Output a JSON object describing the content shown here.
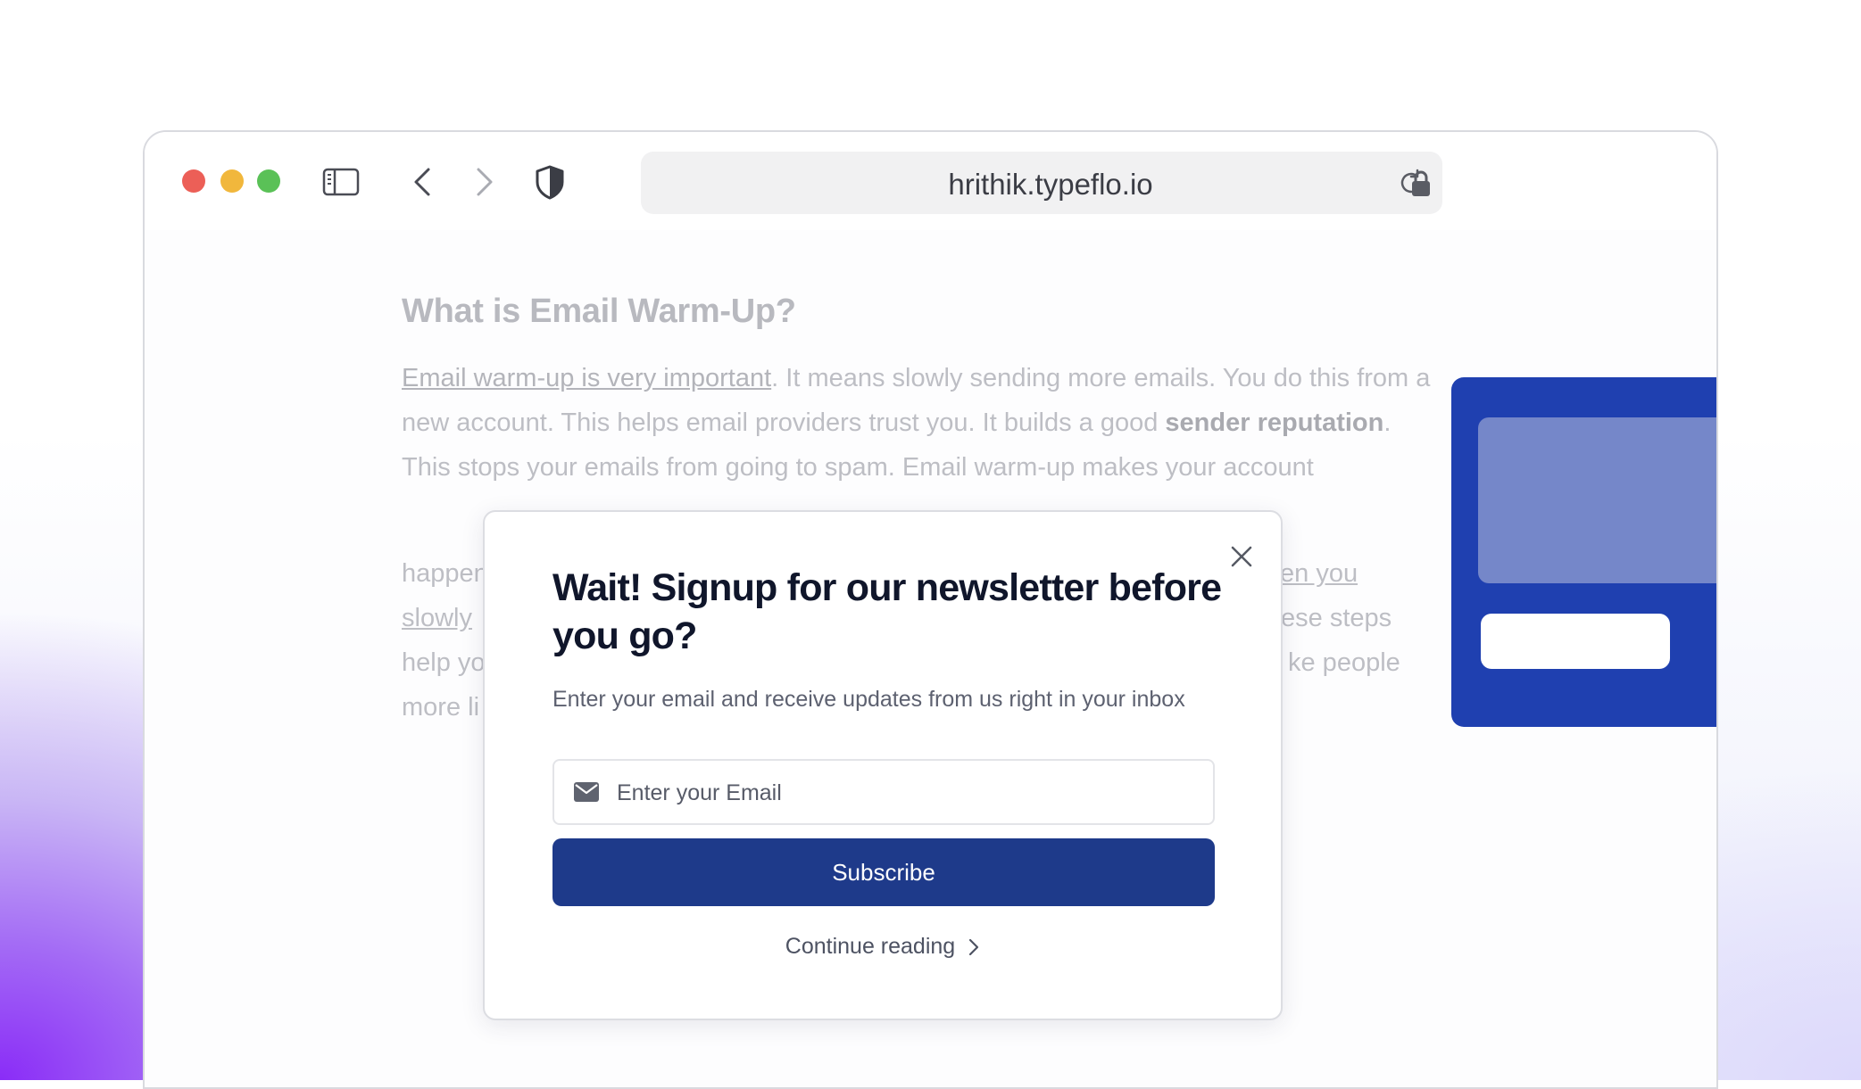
{
  "browser": {
    "url": "hrithik.typeflo.io",
    "icons": [
      "sidebar-icon",
      "back-icon",
      "forward-icon",
      "shield-icon",
      "lock-icon",
      "reload-icon"
    ]
  },
  "article": {
    "heading": "What is Email Warm-Up?",
    "link_text": "Email warm-up is very important",
    "text_1": ". It means slowly sending more emails. You do this from a new account. This helps email providers trust you. It builds a good ",
    "bold_1": "sender reputation",
    "text_2": ". This stops your emails from going to spam. Email warm-up makes your account",
    "line_5_start": "happen",
    "line_5_end": "en you",
    "line_6_start": "slowly",
    "line_6_end": "ese steps",
    "line_7_start": "help yo",
    "line_7_end": "ke people",
    "line_8_start": "more li"
  },
  "modal": {
    "title": "Wait! Signup for our newsletter before you go?",
    "subtitle": "Enter your email and receive updates from us right in your inbox",
    "email_placeholder": "Enter your Email",
    "subscribe_label": "Subscribe",
    "continue_label": "Continue reading"
  },
  "colors": {
    "primary_button": "#1e3a8a",
    "promo_bg": "#1f40b0",
    "title_text": "#10162b"
  }
}
